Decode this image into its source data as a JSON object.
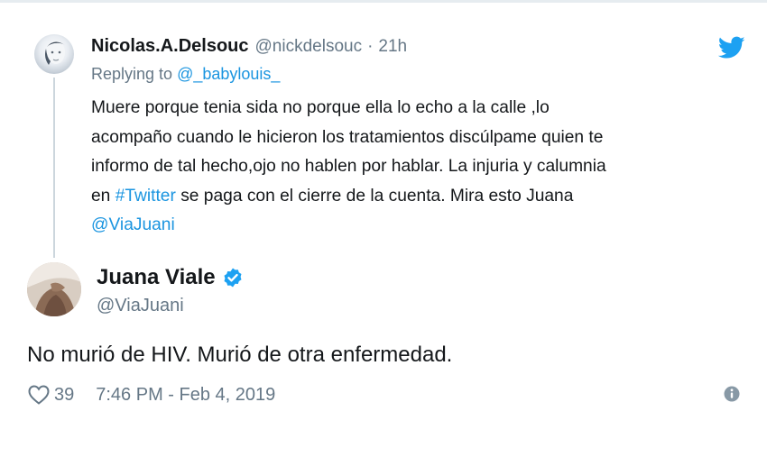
{
  "parent_tweet": {
    "name": "Nicolas.A.Delsouc",
    "handle": "@nickdelsouc",
    "separator": "·",
    "time": "21h",
    "replying_prefix": "Replying to ",
    "replying_mention": "@_babylouis_",
    "text_lines": [
      "Muere porque tenia sida no porque ella lo echo a la calle ,lo",
      "acompaño cuando le hicieron los tratamientos discúlpame quien te",
      "informo de tal hecho,ojo no hablen por hablar. La injuria y calumnia"
    ],
    "line4_prefix": "en ",
    "hashtag": "#Twitter",
    "line4_suffix": " se paga con el cierre de la cuenta. Mira esto Juana",
    "mention": "@ViaJuani"
  },
  "main_tweet": {
    "name": "Juana Viale",
    "handle": "@ViaJuani",
    "text": "No murió de HIV. Murió de otra enfermedad.",
    "likes": "39",
    "timestamp": "7:46 PM - Feb 4, 2019"
  },
  "icons": {
    "brand": "twitter-bird-icon",
    "verified": "verified-badge-icon",
    "like": "heart-icon",
    "info": "info-icon"
  },
  "colors": {
    "link": "#1b95e0",
    "secondary_text": "#657786",
    "primary_text": "#14171a",
    "twitter_blue": "#1da1f2"
  }
}
